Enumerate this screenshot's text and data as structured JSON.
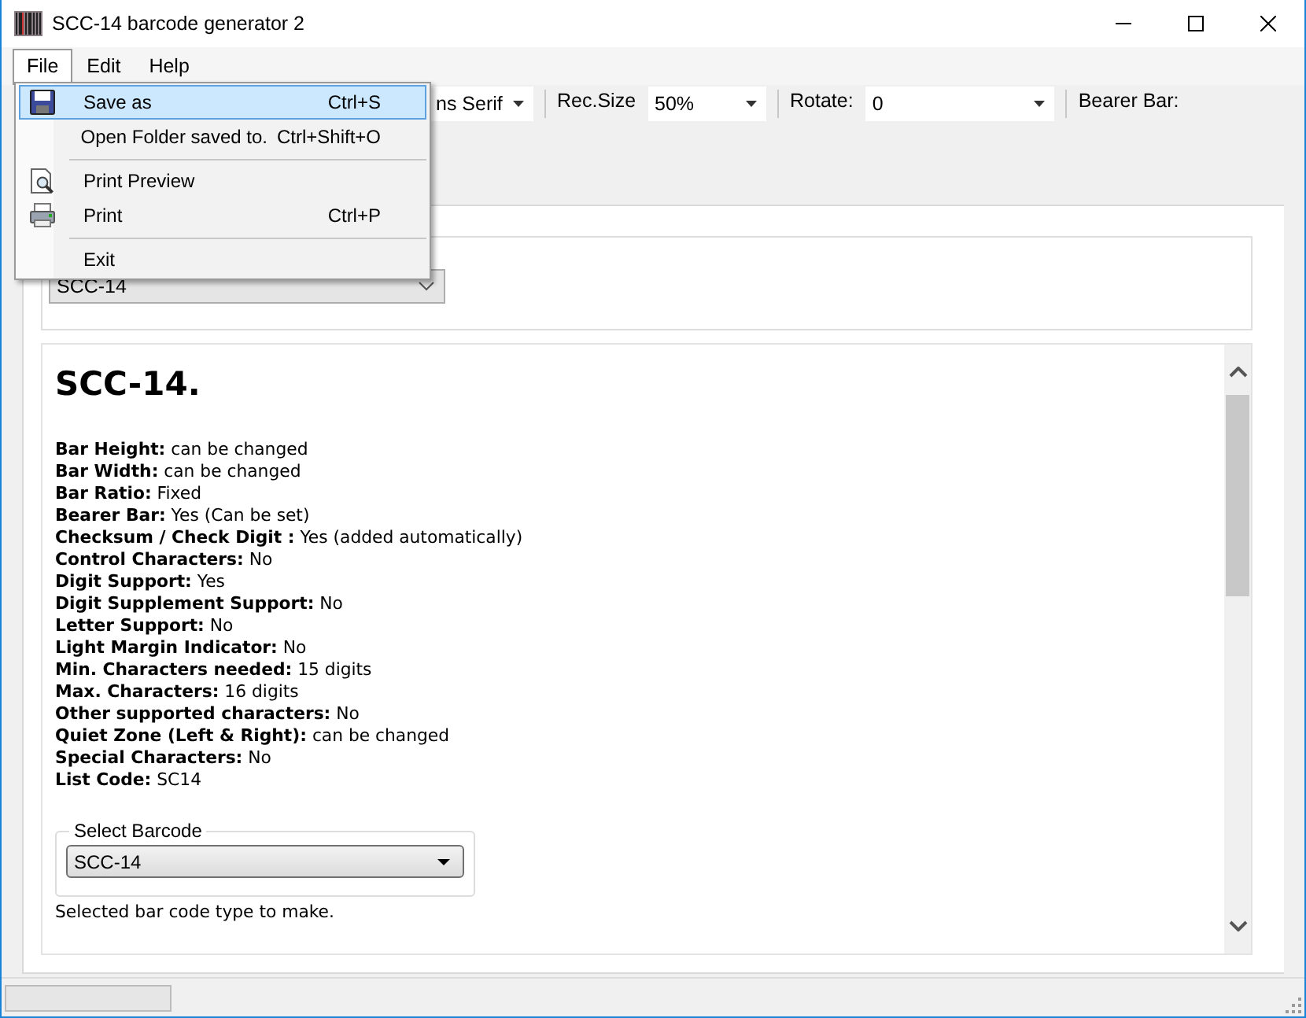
{
  "window": {
    "title": "SCC-14 barcode generator 2"
  },
  "menu_bar": [
    {
      "label": "File",
      "selected": true
    },
    {
      "label": "Edit",
      "selected": false
    },
    {
      "label": "Help",
      "selected": false
    }
  ],
  "toolbar": [
    {
      "kind": "combo",
      "value": "ns Serif"
    },
    {
      "kind": "label",
      "text": "Rec.Size"
    },
    {
      "kind": "combo",
      "value": "50%"
    },
    {
      "kind": "label",
      "text": "Rotate:"
    },
    {
      "kind": "combo",
      "value": "0"
    },
    {
      "kind": "label",
      "text": "Bearer Bar:"
    }
  ],
  "file_menu": [
    {
      "kind": "save",
      "label": "Save as",
      "shortcut": "Ctrl+S",
      "selected": true
    },
    {
      "kind": "item",
      "label": "Open Folder saved to.",
      "shortcut": "Ctrl+Shift+O",
      "selected": false
    },
    {
      "kind": "separator"
    },
    {
      "kind": "preview",
      "label": "Print Preview",
      "selected": false
    },
    {
      "kind": "print",
      "label": "Print",
      "shortcut": "Ctrl+P",
      "selected": false
    },
    {
      "kind": "separator"
    },
    {
      "kind": "item",
      "label": "Exit",
      "selected": false
    }
  ],
  "top_dropdown": {
    "value": "SCC-14"
  },
  "info": {
    "heading": "SCC-14.",
    "properties": [
      {
        "label": "Bar Height:",
        "value": "can be changed"
      },
      {
        "label": "Bar Width:",
        "value": "can be changed"
      },
      {
        "label": "Bar Ratio:",
        "value": "Fixed"
      },
      {
        "label": "Bearer Bar:",
        "value": "Yes (Can be set)"
      },
      {
        "label": "Checksum / Check Digit :",
        "value": "Yes (added automatically)"
      },
      {
        "label": "Control Characters:",
        "value": "No"
      },
      {
        "label": "Digit Support:",
        "value": "Yes"
      },
      {
        "label": "Digit Supplement Support:",
        "value": "No"
      },
      {
        "label": "Letter Support:",
        "value": "No"
      },
      {
        "label": "Light Margin Indicator:",
        "value": "No"
      },
      {
        "label": "Min. Characters needed:",
        "value": "15 digits"
      },
      {
        "label": "Max. Characters:",
        "value": "16 digits"
      },
      {
        "label": "Other supported characters:",
        "value": "No"
      },
      {
        "label": "Quiet Zone (Left & Right):",
        "value": "can be changed"
      },
      {
        "label": "Special Characters:",
        "value": "No"
      },
      {
        "label": "List Code:",
        "value": "SC14"
      }
    ],
    "select_group": {
      "legend": "Select Barcode",
      "value": "SCC-14"
    },
    "note": "Selected bar code type to make."
  },
  "status_bar": {
    "progress": {
      "level": 0
    }
  }
}
